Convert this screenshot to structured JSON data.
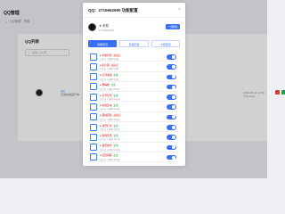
{
  "app": {
    "title": "QQ管理",
    "breadcrumb": [
      "⌂",
      "QQ管理",
      "列表"
    ]
  },
  "background": {
    "card_title": "QQ列表",
    "search_placeholder": "请输入QQ号",
    "row": {
      "id": "QQ",
      "status": "正常在线运行中",
      "time": "2023-05-13 12:00 / 5.0 days"
    }
  },
  "modal": {
    "title": "QQ：2715662690 功能配置",
    "close": "×",
    "account": {
      "name": "★ 未知",
      "id": "2715662690",
      "button": "一键刷新"
    },
    "tabs": [
      {
        "label": "功能配置",
        "active": true
      },
      {
        "label": "高级配置",
        "active": false
      },
      {
        "label": "卡密配置",
        "active": false
      }
    ],
    "items": [
      {
        "icon": "checkin-icon",
        "name": "● 华夏签到",
        "tag": "未开启",
        "tag_color": "red",
        "sub": "已开启 ✦ 频率:3分钟"
      },
      {
        "icon": "like-icon",
        "name": "● 名片赞",
        "tag": "未开启",
        "tag_color": "red",
        "sub": "已开启 ✦ 频率:5分钟"
      },
      {
        "icon": "image-icon",
        "name": "● 空间说说",
        "tag": "正常",
        "tag_color": "green",
        "sub": "已开启 ✦ 频率:5分钟"
      },
      {
        "icon": "chart-icon",
        "name": "● 群等级",
        "tag": "正常",
        "tag_color": "green",
        "sub": "已开启 ✦ 频率:10分钟"
      },
      {
        "icon": "calendar-icon",
        "name": "● 打卡签到",
        "tag": "正常",
        "tag_color": "green",
        "sub": "已开启 ✦ 频率:10分钟"
      },
      {
        "icon": "user-icon",
        "name": "● 好友互动",
        "tag": "正常",
        "tag_color": "green",
        "sub": "已开启 ✦ 频率:10分钟"
      },
      {
        "icon": "message-icon",
        "name": "● 自动回复",
        "tag": "未开启",
        "tag_color": "red",
        "sub": "已开启 ✦ 频率:10分钟"
      },
      {
        "icon": "headset-icon",
        "name": "● 音乐打卡",
        "tag": "正常",
        "tag_color": "green",
        "sub": "已开启 ✦ 频率:10分钟"
      },
      {
        "icon": "game-icon",
        "name": "● 游戏签到",
        "tag": "正常",
        "tag_color": "green",
        "sub": "已开启 ✦ 频率:10分钟"
      },
      {
        "icon": "star-icon",
        "name": "● 会员成长",
        "tag": "正常",
        "tag_color": "green",
        "sub": "已开启 ✦ 频率:10分钟"
      },
      {
        "icon": "gift-icon",
        "name": "● 红包领取",
        "tag": "正常",
        "tag_color": "green",
        "sub": "已开启 ✦ 频率:10分钟"
      }
    ]
  }
}
